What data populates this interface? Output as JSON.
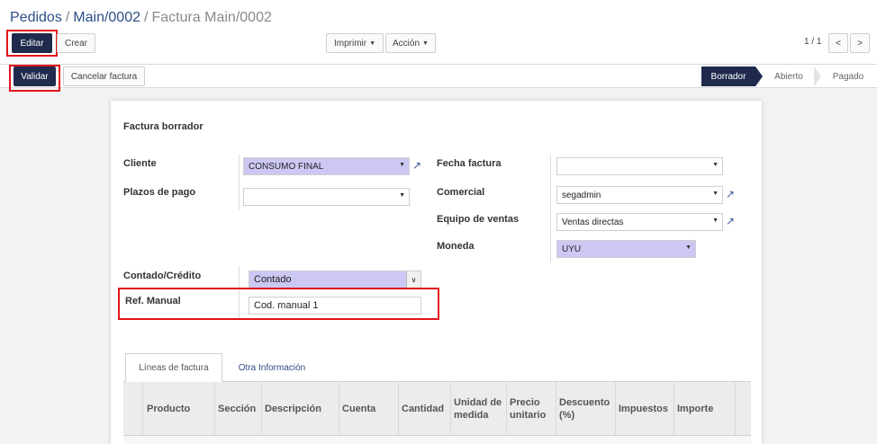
{
  "breadcrumb": {
    "item1": "Pedidos",
    "item2": "Main/0002",
    "current": "Factura Main/0002",
    "sep": "/"
  },
  "toolbar": {
    "edit": "Editar",
    "create": "Crear",
    "print": "Imprimir",
    "action": "Acción",
    "pager": "1 / 1",
    "prev": "<",
    "next": ">"
  },
  "status": {
    "validate": "Validar",
    "cancel": "Cancelar factura",
    "stages": [
      "Borrador",
      "Abierto",
      "Pagado"
    ]
  },
  "form": {
    "title": "Factura borrador",
    "left": {
      "customer_label": "Cliente",
      "customer_value": "CONSUMO FINAL",
      "payment_terms_label": "Plazos de pago",
      "payment_terms_value": ""
    },
    "right": {
      "invoice_date_label": "Fecha factura",
      "invoice_date_value": "",
      "salesperson_label": "Comercial",
      "salesperson_value": "segadmin",
      "sales_team_label": "Equipo de ventas",
      "sales_team_value": "Ventas directas",
      "currency_label": "Moneda",
      "currency_value": "UYU"
    },
    "cash_credit_label": "Contado/Crédito",
    "cash_credit_value": "Contado",
    "manual_ref_label": "Ref. Manual",
    "manual_ref_value": "Cod. manual 1"
  },
  "tabs": [
    "Líneas de factura",
    "Otra Información"
  ],
  "table": {
    "headers": [
      "Producto",
      "Sección",
      "Descripción",
      "Cuenta",
      "Cantidad",
      "Unidad de medida",
      "Precio unitario",
      "Descuento (%)",
      "Impuestos",
      "Importe"
    ]
  },
  "colors": {
    "primary": "#1f2a4d",
    "highlight": "#e0141c",
    "required": "#ccc8f3",
    "link": "#2b4f86"
  }
}
